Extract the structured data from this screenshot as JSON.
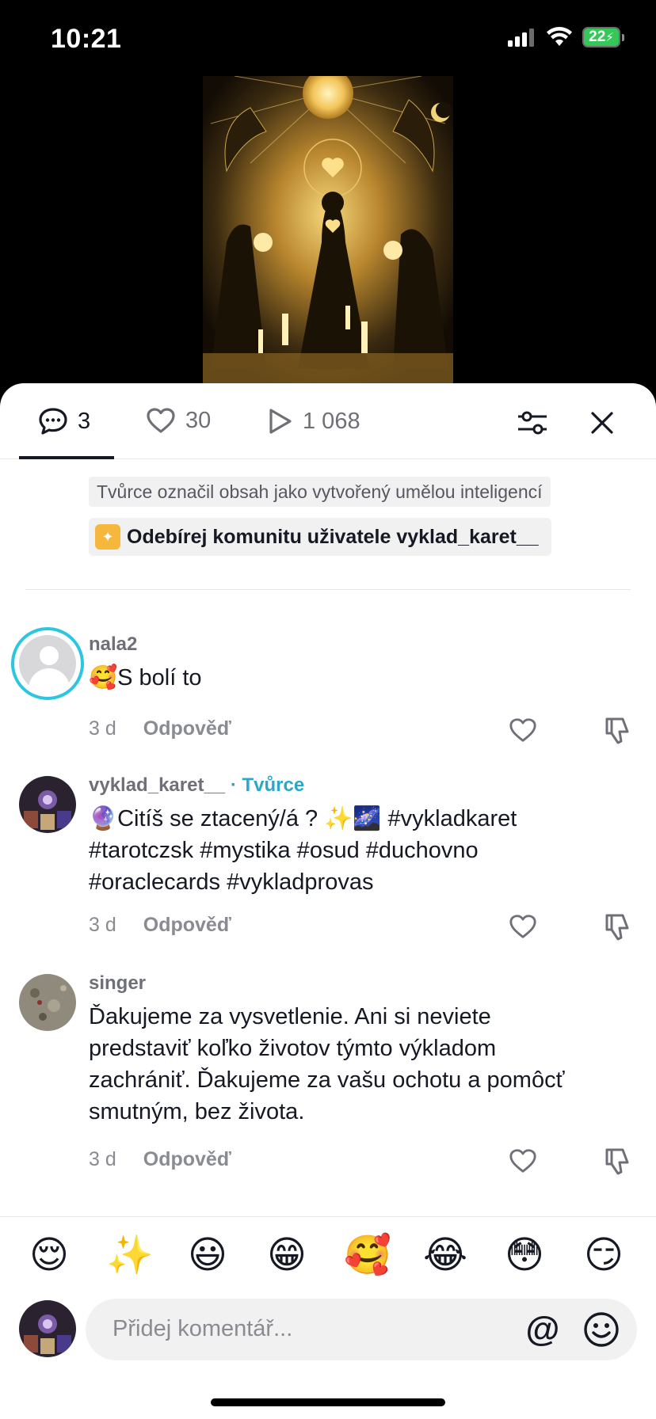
{
  "status": {
    "time": "10:21",
    "battery": "22"
  },
  "tabs": {
    "comments_count": "3",
    "likes_count": "30",
    "plays_count": "1 068"
  },
  "header": {
    "ai_label": "Tvůrce označil obsah jako vytvořený umělou inteligencí",
    "community_label": "Odebírej komunitu uživatele vyklad_karet__"
  },
  "comments": [
    {
      "user": "nala2",
      "creator_tag": "",
      "emoji": "🥰",
      "text": "S bolí to",
      "age": "3 d",
      "reply": "Odpověď"
    },
    {
      "user": "vyklad_karet__",
      "creator_tag": "· Tvůrce",
      "emoji": "🔮",
      "text": "Citíš se ztacený/á ? ✨🌌 #vykladkaret #tarotczsk #mystika #osud #duchovno #oraclecards #vykladprovas",
      "age": "3 d",
      "reply": "Odpověď"
    },
    {
      "user": "singer",
      "creator_tag": "",
      "emoji": "",
      "text": "Ďakujeme za vysvetlenie. Ani si neviete predstaviť koľko životov týmto výkladom zachrániť. Ďakujeme za vašu ochotu a pomôcť smutným, bez života.",
      "age": "3 d",
      "reply": "Odpověď"
    }
  ],
  "emoji_bar": [
    "😌",
    "✨",
    "😃",
    "😁",
    "🥰",
    "😂",
    "😳",
    "😏"
  ],
  "composer": {
    "placeholder": "Přidej komentář...",
    "at_symbol": "@"
  },
  "icons": {
    "comment": "comment-bubble-icon",
    "like": "heart-icon",
    "plays": "play-icon",
    "filter": "filter-sliders-icon",
    "close": "close-icon",
    "dislike": "thumbs-down-icon",
    "smile": "smile-icon"
  },
  "colors": {
    "accent": "#2aa7c9",
    "ring": "#2cc6e0",
    "battery": "#36c759"
  }
}
